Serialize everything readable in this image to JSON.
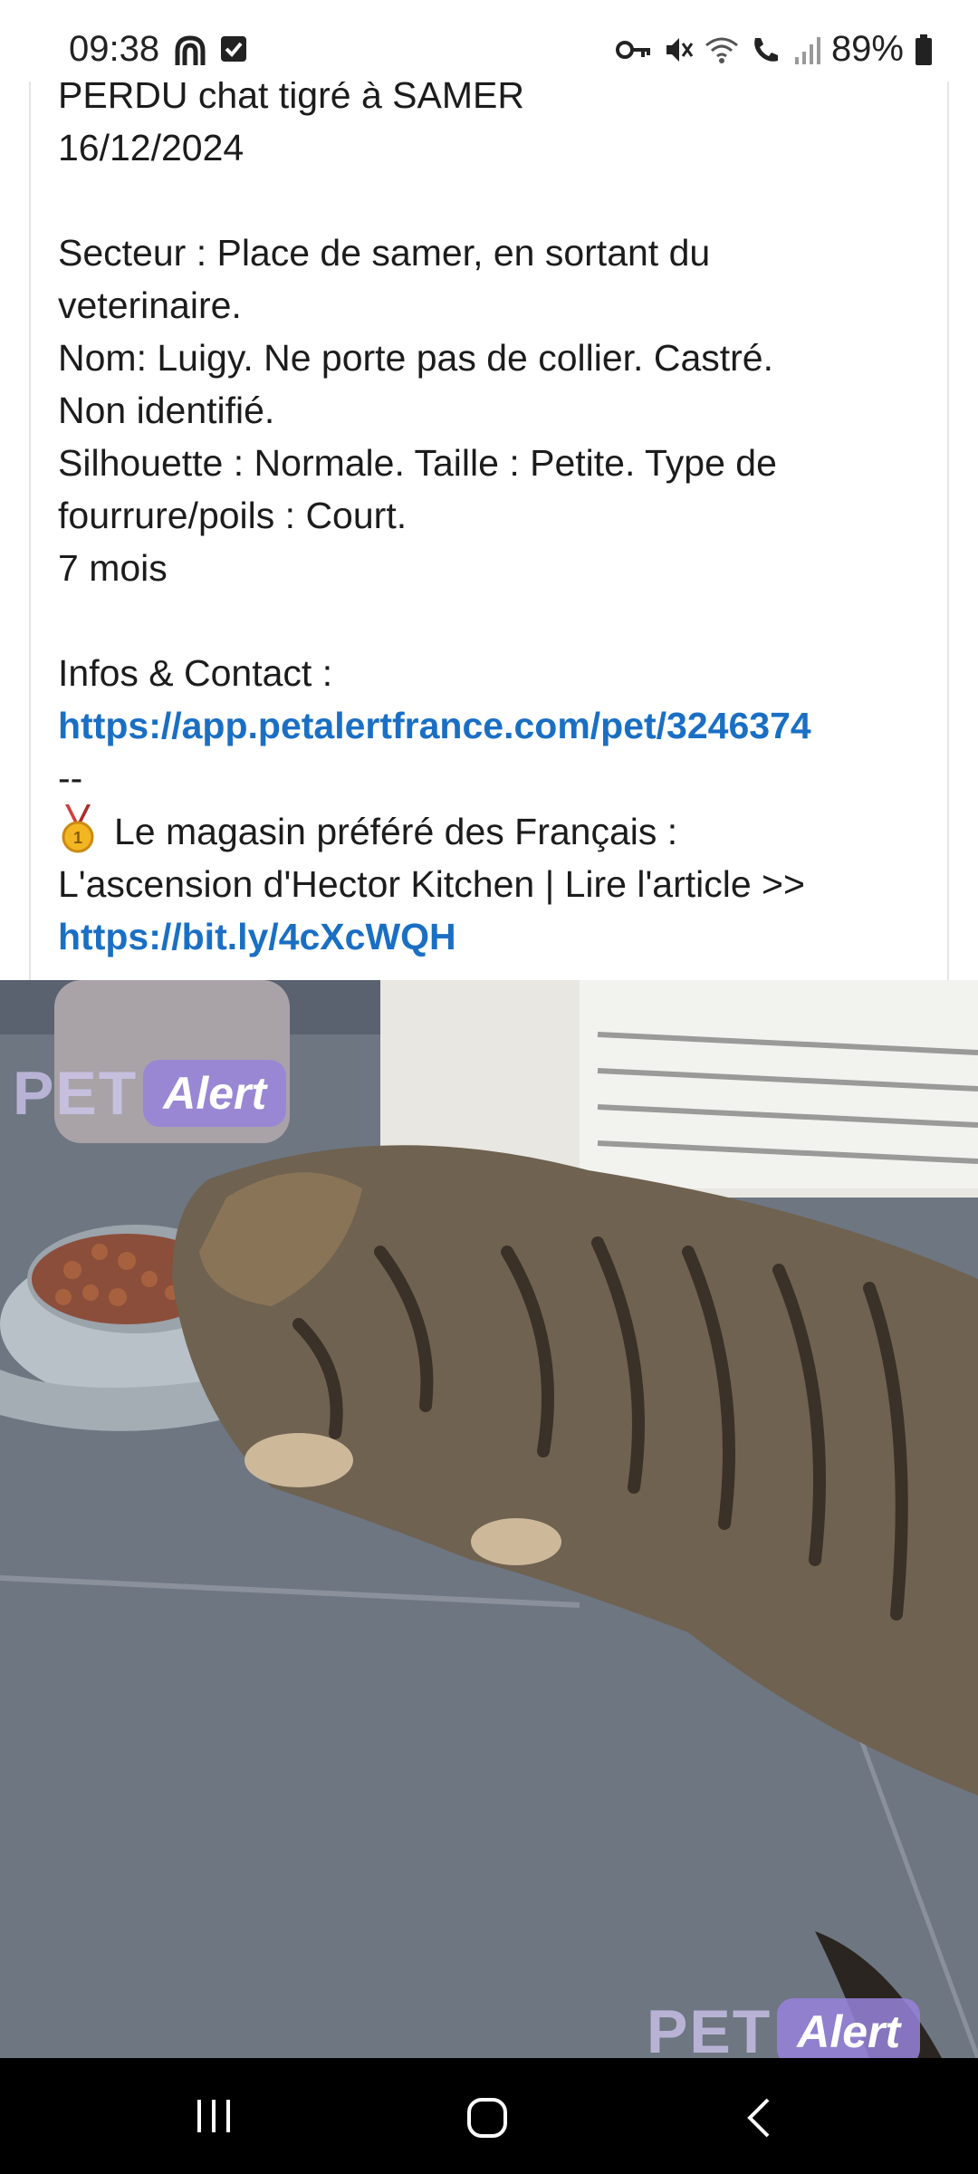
{
  "status_bar": {
    "time": "09:38",
    "battery": "89%",
    "left_icons": [
      "notification-icon",
      "checkbox-icon"
    ],
    "right_icons": [
      "key-icon",
      "mute-icon",
      "wifi-icon",
      "wifi-call-icon",
      "signal-icon",
      "battery-icon"
    ]
  },
  "post": {
    "lines": [
      "PERDU chat tigré à SAMER",
      "16/12/2024",
      "",
      "Secteur : Place de samer, en sortant du",
      "veterinaire.",
      "Nom: Luigy. Ne porte pas de collier. Castré.",
      "Non identifié.",
      "Silhouette : Normale. Taille : Petite. Type de",
      "fourrure/poils : Court.",
      "7 mois",
      "",
      "Infos & Contact :"
    ],
    "info_link": "https://app.petalertfrance.com/pet/3246374",
    "separator": "--",
    "promo_line1": "Le magasin préféré des Français :",
    "promo_line2": "L'ascension d'Hector Kitchen | Lire l'article >>",
    "promo_link": "https://bit.ly/4cXcWQH"
  },
  "photo": {
    "watermark_pet": "PET",
    "watermark_alert": "Alert",
    "description_icon": "tabby-cat-eating-photo"
  },
  "nav": {
    "icons": [
      "recent-apps-icon",
      "home-icon",
      "back-icon"
    ]
  }
}
